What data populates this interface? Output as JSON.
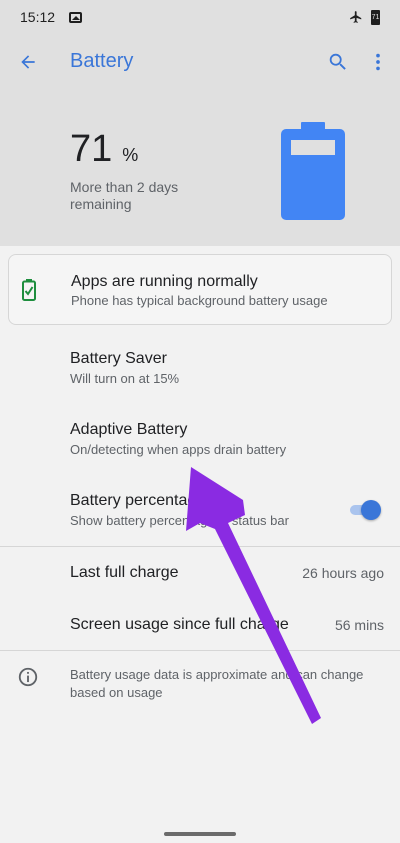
{
  "status_bar": {
    "time": "15:12",
    "battery_level": "71"
  },
  "app_bar": {
    "title": "Battery",
    "icons": [
      "back-arrow-icon",
      "search-icon",
      "more-vert-icon"
    ]
  },
  "summary": {
    "percent": "71",
    "percent_sign": "%",
    "remaining": "More than 2 days remaining",
    "battery_fill_fraction": 0.71
  },
  "status_card": {
    "title": "Apps are running normally",
    "subtitle": "Phone has typical background battery usage"
  },
  "preferences": [
    {
      "title": "Battery Saver",
      "subtitle": "Will turn on at 15%"
    },
    {
      "title": "Adaptive Battery",
      "subtitle": "On/detecting when apps drain battery"
    },
    {
      "title": "Battery percentage",
      "subtitle": "Show battery percentage in status bar",
      "toggle_on": true
    }
  ],
  "stats": [
    {
      "label": "Last full charge",
      "value": "26 hours ago"
    },
    {
      "label": "Screen usage since full charge",
      "value": "56 mins"
    }
  ],
  "footer": {
    "text": "Battery usage data is approximate and can change based on usage"
  },
  "colors": {
    "accent": "#3a76d8",
    "battery_blue": "#4285f4",
    "good_green": "#1e8e3e",
    "annotation_purple": "#8a2be2"
  }
}
